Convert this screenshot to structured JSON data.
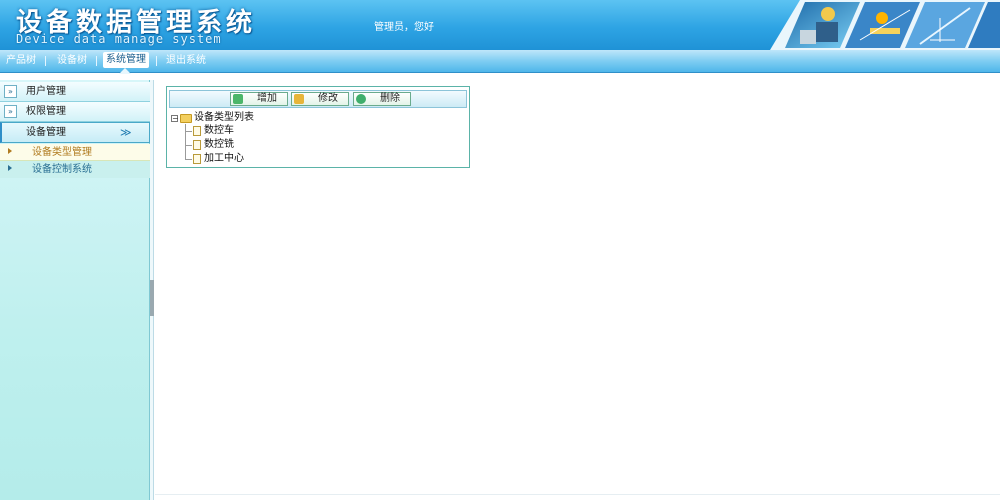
{
  "header": {
    "title": "设备数据管理系统",
    "subtitle": "Device data manage system",
    "welcome": "管理员，您好"
  },
  "nav": {
    "items": [
      {
        "label": "产品树"
      },
      {
        "label": "设备树"
      },
      {
        "label": "系统管理",
        "active": true
      },
      {
        "label": "退出系统"
      }
    ]
  },
  "sidebar": {
    "groups": [
      {
        "label": "用户管理"
      },
      {
        "label": "权限管理"
      },
      {
        "label": "设备管理",
        "open": true
      }
    ],
    "items": [
      {
        "label": "设备类型管理",
        "selected": true
      },
      {
        "label": "设备控制系统"
      }
    ]
  },
  "toolbar": {
    "add_label": "增加",
    "edit_label": "修改",
    "delete_label": "删除"
  },
  "tree": {
    "root": "设备类型列表",
    "children": [
      "数控车",
      "数控铣",
      "加工中心"
    ]
  },
  "colors": {
    "header": "#2ea4e4",
    "sidebar": "#bff0ee",
    "panel_border": "#5bb3a8",
    "selected_text": "#b07a1f"
  }
}
